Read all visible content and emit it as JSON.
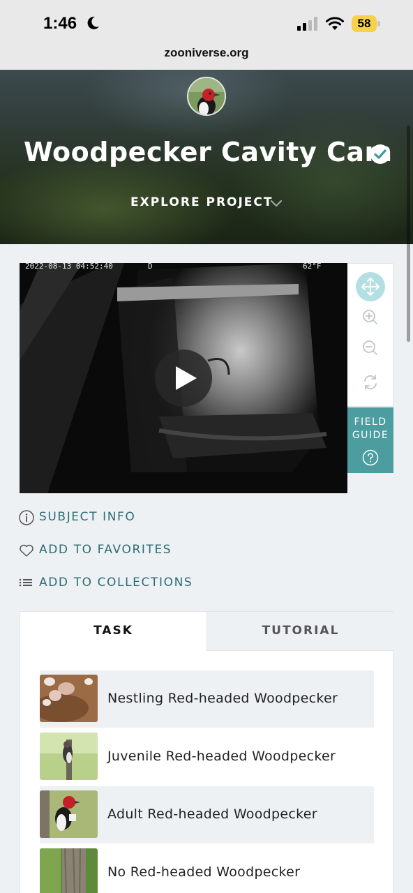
{
  "status_bar": {
    "time": "1:46",
    "battery": "58",
    "icons": [
      "moon-icon",
      "cellular-signal-icon",
      "wifi-icon",
      "battery-icon"
    ]
  },
  "browser": {
    "url": "zooniverse.org"
  },
  "hero": {
    "title": "Woodpecker Cavity Cam",
    "explore_label": "EXPLORE PROJECT"
  },
  "viewer": {
    "timestamp": "2022-08-13 04:52:40",
    "camera_code": "D",
    "temperature": "62°F",
    "tools": [
      "move-icon",
      "zoom-in-icon",
      "zoom-out-icon",
      "rotate-icon"
    ],
    "field_guide_line1": "FIELD",
    "field_guide_line2": "GUIDE"
  },
  "subject_actions": {
    "info": "SUBJECT INFO",
    "favorites": "ADD TO FAVORITES",
    "collections": "ADD TO COLLECTIONS"
  },
  "panel": {
    "tabs": [
      {
        "label": "TASK",
        "active": true
      },
      {
        "label": "TUTORIAL",
        "active": false
      }
    ],
    "choices": [
      {
        "label": "Nestling Red-headed Woodpecker"
      },
      {
        "label": "Juvenile Red-headed Woodpecker"
      },
      {
        "label": "Adult Red-headed Woodpecker"
      },
      {
        "label": "No Red-headed Woodpecker"
      }
    ]
  },
  "colors": {
    "accent": "#2b6d73",
    "field_guide": "#4c9da0",
    "move_tool": "#b3dfe3",
    "battery": "#f6d24a"
  }
}
